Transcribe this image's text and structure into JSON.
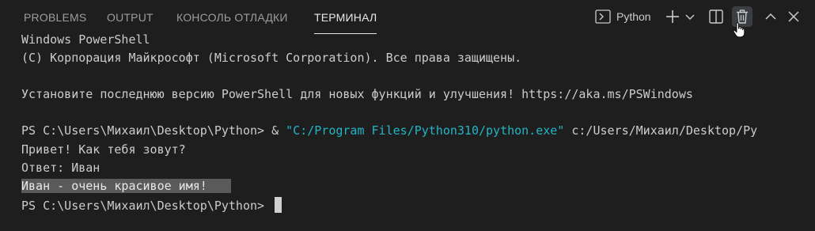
{
  "tabs": {
    "problems": "PROBLEMS",
    "output": "OUTPUT",
    "debug_console": "КОНСОЛЬ ОТЛАДКИ",
    "terminal": "ТЕРМИНАЛ",
    "active": "terminal"
  },
  "toolbar": {
    "profile_label": "Python",
    "icons": [
      "terminal-icon",
      "plus-icon",
      "chevron-down-icon",
      "split-icon",
      "trash-icon",
      "chevron-up-icon",
      "close-icon"
    ]
  },
  "terminal": {
    "line1": "Windows PowerShell",
    "line2": "(C) Корпорация Майкрософт (Microsoft Corporation). Все права защищены.",
    "line3": "Установите последнюю версию PowerShell для новых функций и улучшения! https://aka.ms/PSWindows",
    "prompt1": "PS C:\\Users\\Михаил\\Desktop\\Python> & ",
    "command_exe": "\"C:/Program Files/Python310/python.exe\"",
    "command_arg": " c:/Users/Михаил/Desktop/Py",
    "line5": "Привет! Как тебя зовут?",
    "line6": "Ответ: Иван",
    "line7_selected": "Иван - очень красивое имя!",
    "prompt2": "PS C:\\Users\\Михаил\\Desktop\\Python> "
  },
  "colors": {
    "background": "#1e1e1e",
    "text": "#cccccc",
    "string": "#23b5c7",
    "selection": "#5a5a5a",
    "tab_inactive": "#9d9d9d",
    "tab_active": "#e7e7e7"
  }
}
